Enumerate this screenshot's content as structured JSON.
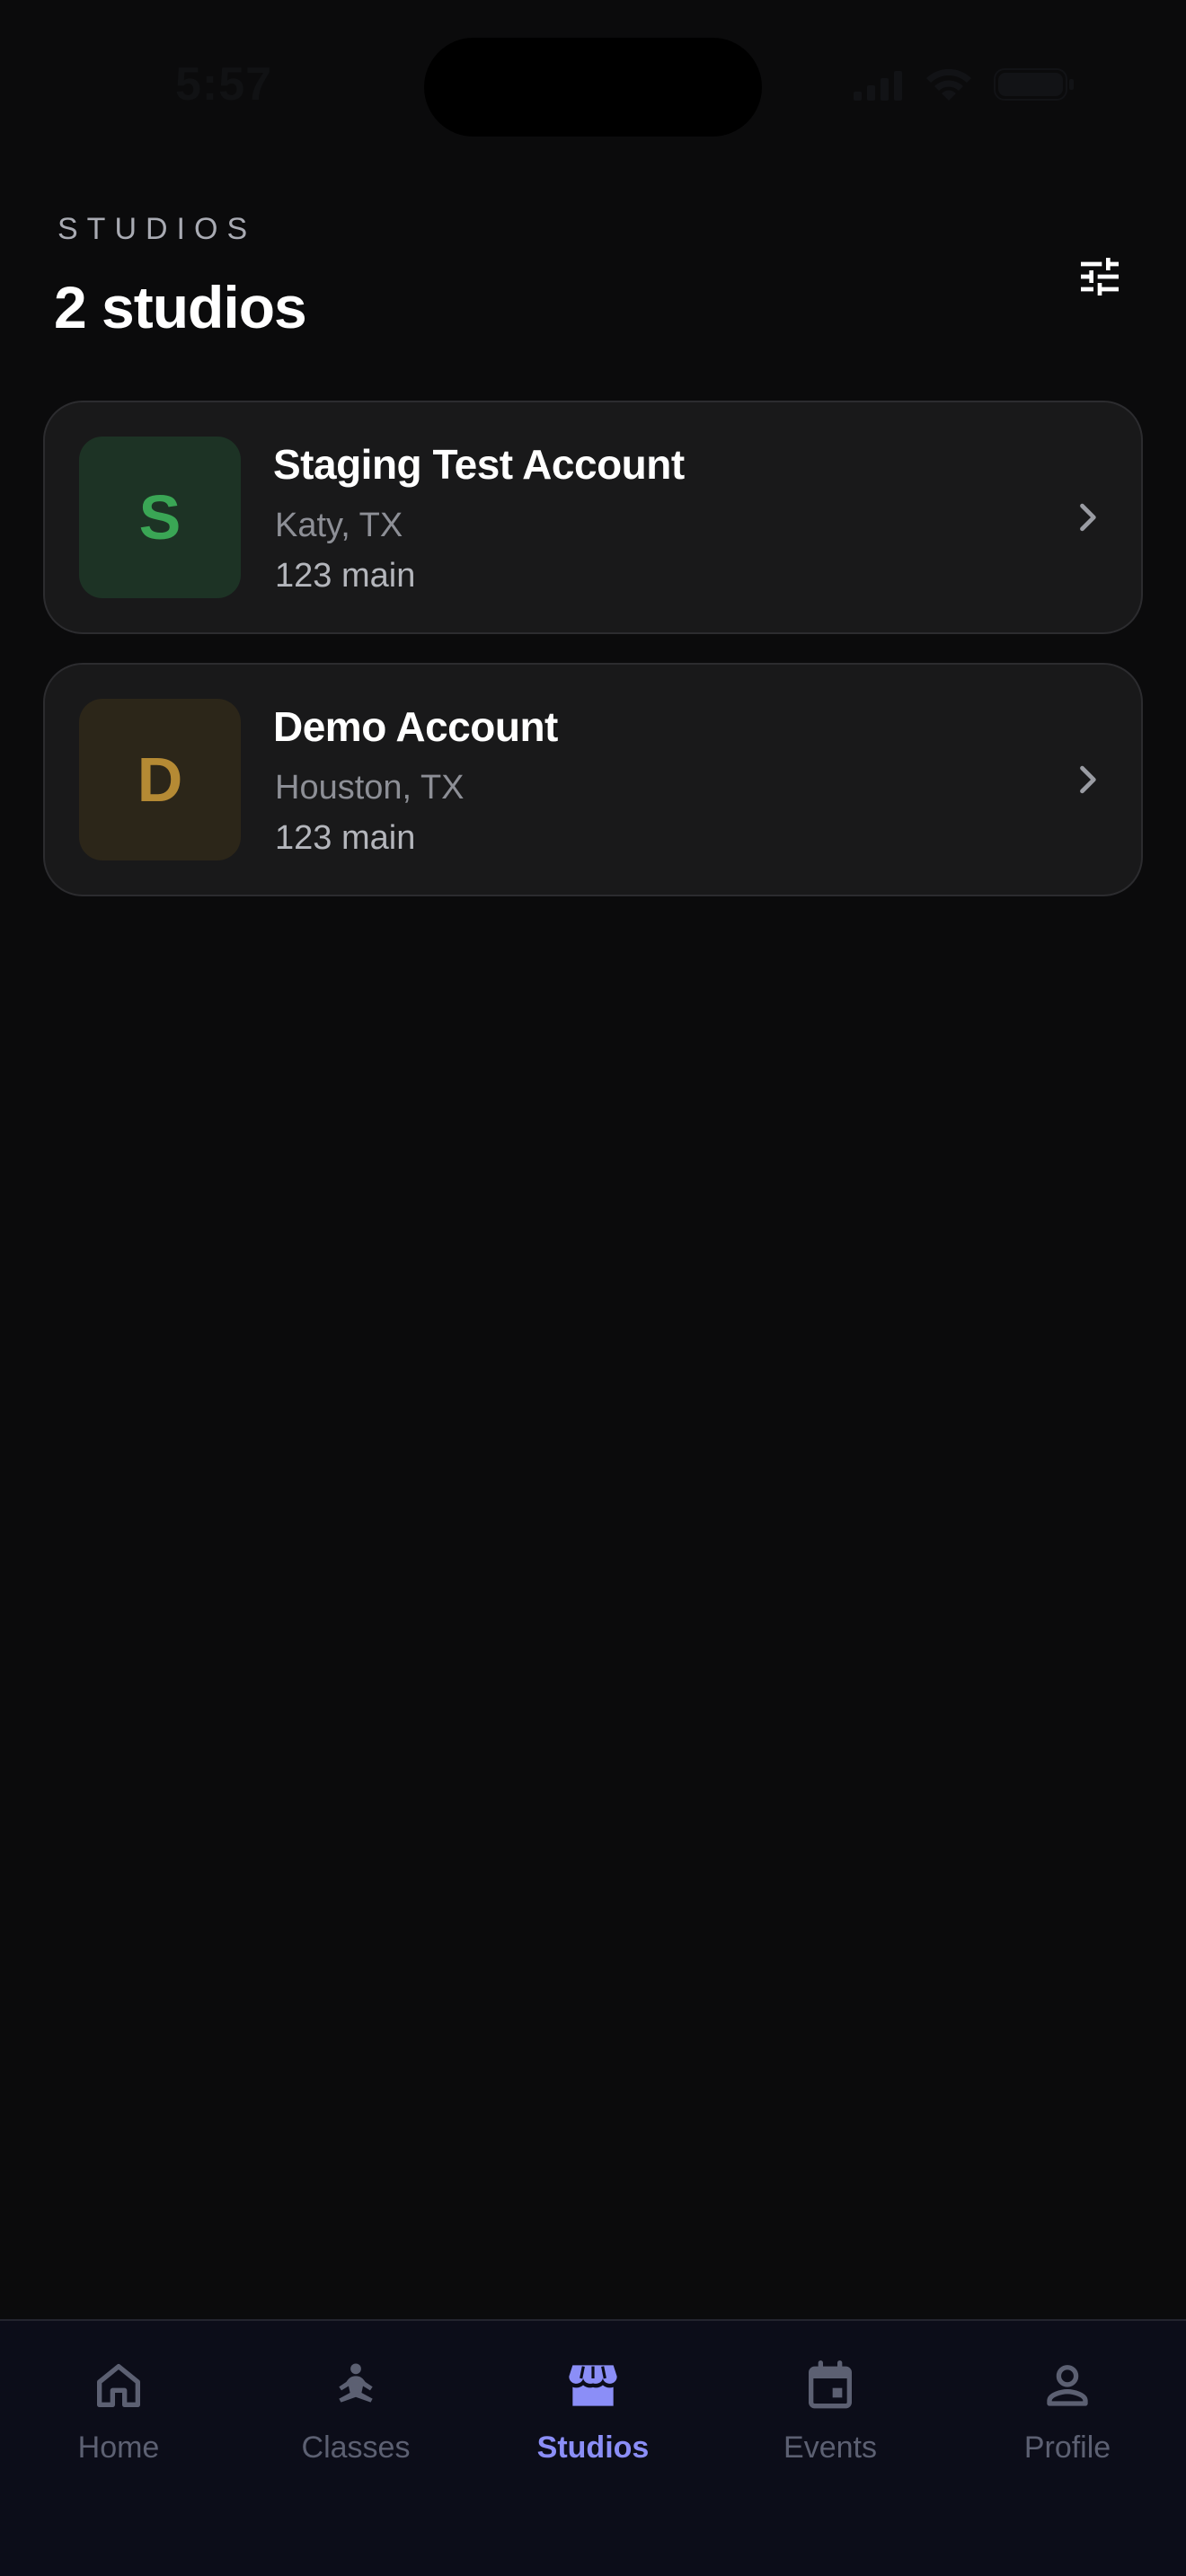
{
  "status_bar": {
    "time": "5:57"
  },
  "header": {
    "eyebrow": "STUDIOS",
    "title": "2 studios",
    "filter_icon": "sliders-icon"
  },
  "studios": [
    {
      "initial": "S",
      "name": "Staging Test Account",
      "location": "Katy, TX",
      "address": "123 main",
      "avatar_bg": "#1d3325",
      "avatar_fg": "#3aa655"
    },
    {
      "initial": "D",
      "name": "Demo Account",
      "location": "Houston, TX",
      "address": "123 main",
      "avatar_bg": "#2c2619",
      "avatar_fg": "#b58a34"
    }
  ],
  "tabs": [
    {
      "label": "Home",
      "icon": "home-icon",
      "active": false
    },
    {
      "label": "Classes",
      "icon": "meditation-icon",
      "active": false
    },
    {
      "label": "Studios",
      "icon": "storefront-icon",
      "active": true
    },
    {
      "label": "Events",
      "icon": "calendar-icon",
      "active": false
    },
    {
      "label": "Profile",
      "icon": "person-icon",
      "active": false
    }
  ],
  "colors": {
    "background": "#0b0b0c",
    "card": "#19191a",
    "accent": "#8b8ef7",
    "tab_inactive": "#5c6072"
  }
}
